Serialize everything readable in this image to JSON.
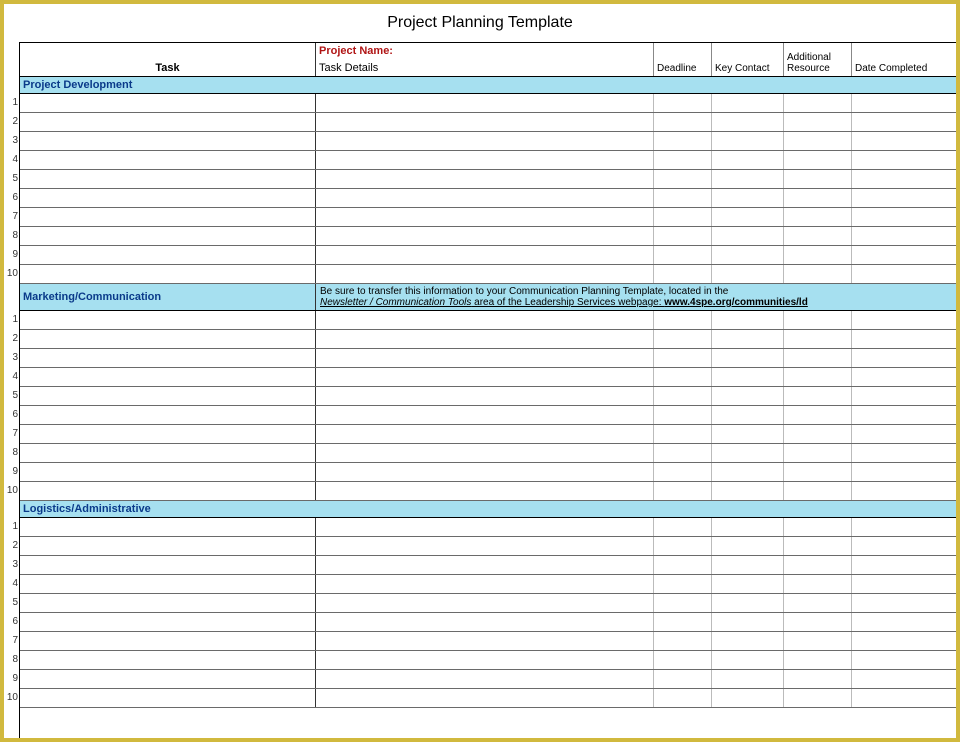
{
  "title": "Project Planning Template",
  "header": {
    "projectNameLabel": "Project Name:",
    "taskHeader": "Task",
    "taskDetails": "Task Details",
    "deadline": "Deadline",
    "keyContact": "Key Contact",
    "additionalResource": "Additional Resource",
    "dateCompleted": "Date Completed"
  },
  "sections": [
    {
      "label": "Project Development",
      "note": null,
      "rows": 10
    },
    {
      "label": "Marketing/Communication",
      "note": {
        "pre": "Be sure to transfer this information to your Communication Planning Template, located in the",
        "mid": "Newsletter / Communication Tools",
        "post": " area of the Leadership Services webpage: ",
        "link": "www.4spe.org/communities/ld"
      },
      "rows": 10
    },
    {
      "label": "Logistics/Administrative",
      "note": null,
      "rows": 10
    }
  ],
  "row_numbers": [
    "1",
    "2",
    "3",
    "4",
    "5",
    "6",
    "7",
    "8",
    "9",
    "10"
  ]
}
